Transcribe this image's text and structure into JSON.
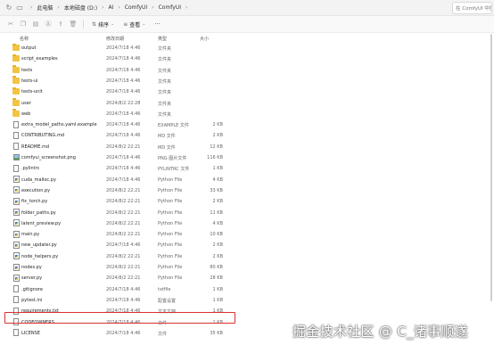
{
  "address": {
    "crumbs": [
      "此电脑",
      "本地磁盘 (D:)",
      "AI",
      "ComfyUI",
      "ComfyUI"
    ],
    "search_placeholder": "在 ComfyUI 中搜索"
  },
  "toolbar": {
    "sort_label": "排序",
    "view_label": "查看",
    "more_label": "···"
  },
  "columns": {
    "name": "名称",
    "date": "修改日期",
    "type": "类型",
    "size": "大小"
  },
  "files": [
    {
      "name": "output",
      "date": "2024/7/18 4:46",
      "type": "文件夹",
      "size": "",
      "icon": "folder"
    },
    {
      "name": "script_examples",
      "date": "2024/7/18 4:46",
      "type": "文件夹",
      "size": "",
      "icon": "folder"
    },
    {
      "name": "tests",
      "date": "2024/7/18 4:46",
      "type": "文件夹",
      "size": "",
      "icon": "folder"
    },
    {
      "name": "tests-ui",
      "date": "2024/7/18 4:46",
      "type": "文件夹",
      "size": "",
      "icon": "folder"
    },
    {
      "name": "tests-unit",
      "date": "2024/7/18 4:46",
      "type": "文件夹",
      "size": "",
      "icon": "folder"
    },
    {
      "name": "user",
      "date": "2024/8/2 22:28",
      "type": "文件夹",
      "size": "",
      "icon": "folder"
    },
    {
      "name": "web",
      "date": "2024/7/18 4:46",
      "type": "文件夹",
      "size": "",
      "icon": "folder"
    },
    {
      "name": "extra_model_paths.yaml.example",
      "date": "2024/7/18 4:46",
      "type": "EXAMPLE 文件",
      "size": "2 KB",
      "icon": "file"
    },
    {
      "name": "CONTRIBUTING.md",
      "date": "2024/7/18 4:46",
      "type": "MD 文件",
      "size": "2 KB",
      "icon": "file"
    },
    {
      "name": "README.md",
      "date": "2024/8/2 22:21",
      "type": "MD 文件",
      "size": "12 KB",
      "icon": "file"
    },
    {
      "name": "comfyui_screenshot.png",
      "date": "2024/7/18 4:46",
      "type": "PNG 图片文件",
      "size": "116 KB",
      "icon": "image"
    },
    {
      "name": ".pylintrc",
      "date": "2024/7/18 4:46",
      "type": "PYLINTRC 文件",
      "size": "1 KB",
      "icon": "file"
    },
    {
      "name": "cuda_malloc.py",
      "date": "2024/7/18 4:46",
      "type": "Python File",
      "size": "4 KB",
      "icon": "python"
    },
    {
      "name": "execution.py",
      "date": "2024/8/2 22:21",
      "type": "Python File",
      "size": "33 KB",
      "icon": "python"
    },
    {
      "name": "fix_torch.py",
      "date": "2024/8/2 22:21",
      "type": "Python File",
      "size": "2 KB",
      "icon": "python"
    },
    {
      "name": "folder_paths.py",
      "date": "2024/8/2 22:21",
      "type": "Python File",
      "size": "11 KB",
      "icon": "python"
    },
    {
      "name": "latent_preview.py",
      "date": "2024/8/2 22:21",
      "type": "Python File",
      "size": "4 KB",
      "icon": "python"
    },
    {
      "name": "main.py",
      "date": "2024/8/2 22:21",
      "type": "Python File",
      "size": "10 KB",
      "icon": "python"
    },
    {
      "name": "new_updater.py",
      "date": "2024/7/18 4:46",
      "type": "Python File",
      "size": "2 KB",
      "icon": "python"
    },
    {
      "name": "node_helpers.py",
      "date": "2024/8/2 22:21",
      "type": "Python File",
      "size": "2 KB",
      "icon": "python"
    },
    {
      "name": "nodes.py",
      "date": "2024/8/2 22:21",
      "type": "Python File",
      "size": "80 KB",
      "icon": "python"
    },
    {
      "name": "server.py",
      "date": "2024/8/2 22:21",
      "type": "Python File",
      "size": "28 KB",
      "icon": "python"
    },
    {
      "name": ".gitignore",
      "date": "2024/7/18 4:46",
      "type": "txtfile",
      "size": "1 KB",
      "icon": "file"
    },
    {
      "name": "pytest.ini",
      "date": "2024/7/18 4:46",
      "type": "配置设置",
      "size": "1 KB",
      "icon": "file"
    },
    {
      "name": "requirements.txt",
      "date": "2024/7/18 4:46",
      "type": "文本文档",
      "size": "1 KB",
      "icon": "file"
    },
    {
      "name": "CODEOWNERS",
      "date": "2024/7/18 4:46",
      "type": "文件",
      "size": "1 KB",
      "icon": "file"
    },
    {
      "name": "LICENSE",
      "date": "2024/7/18 4:46",
      "type": "文件",
      "size": "35 KB",
      "icon": "file"
    }
  ],
  "selected_file": "requirements.txt",
  "watermark": "掘金技术社区 @ C_诸事顺遂",
  "colors": {
    "folder": "#f2c443",
    "highlight_border": "#d9302c"
  }
}
